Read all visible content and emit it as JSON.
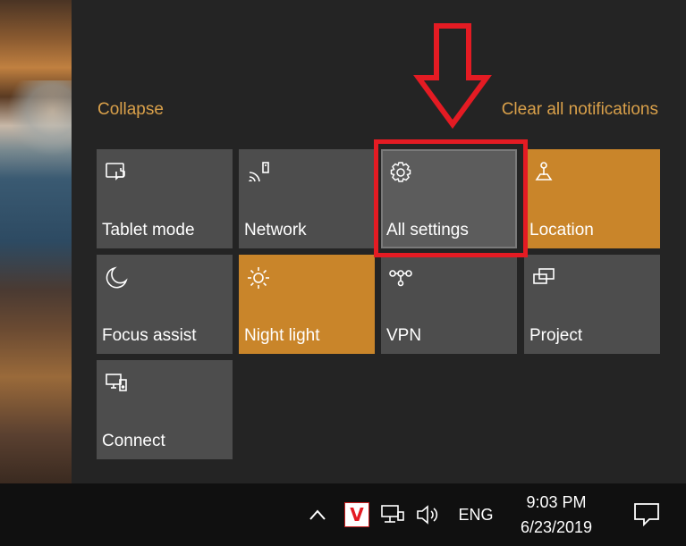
{
  "action_center": {
    "collapse_label": "Collapse",
    "clear_all_label": "Clear all notifications",
    "tiles": [
      {
        "label": "Tablet mode",
        "icon": "tablet-mode-icon",
        "state": "off"
      },
      {
        "label": "Network",
        "icon": "network-icon",
        "state": "off"
      },
      {
        "label": "All settings",
        "icon": "gear-icon",
        "state": "hover"
      },
      {
        "label": "Location",
        "icon": "location-icon",
        "state": "on"
      },
      {
        "label": "Focus assist",
        "icon": "moon-icon",
        "state": "off"
      },
      {
        "label": "Night light",
        "icon": "sun-icon",
        "state": "on"
      },
      {
        "label": "VPN",
        "icon": "vpn-icon",
        "state": "off"
      },
      {
        "label": "Project",
        "icon": "project-icon",
        "state": "off"
      },
      {
        "label": "Connect",
        "icon": "connect-icon",
        "state": "off"
      }
    ]
  },
  "taskbar": {
    "chevron_glyph": "^",
    "antivirus_glyph": "V",
    "language": "ENG",
    "time": "9:03 PM",
    "date": "6/23/2019"
  },
  "colors": {
    "tile_off": "#4d4d4d",
    "tile_on": "#c9852a",
    "accent_text": "#d9a04a",
    "annotation_red": "#e41b23",
    "taskbar": "#101010"
  }
}
